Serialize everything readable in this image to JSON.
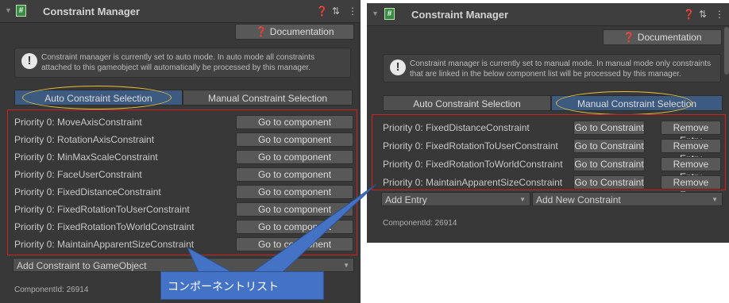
{
  "left": {
    "title": "Constraint Manager",
    "title_icons": [
      "help-icon",
      "sliders-icon",
      "kebab-menu-icon"
    ],
    "doc_button": "Documentation",
    "doc_icon": "help-icon",
    "help_text": "Constraint manager is currently set to auto mode. In auto mode all constraints attached to this gameobject will automatically be processed by this manager.",
    "tabs": [
      {
        "label": "Auto Constraint Selection",
        "active": true
      },
      {
        "label": "Manual Constraint Selection",
        "active": false
      }
    ],
    "rows": [
      {
        "label": "Priority 0: MoveAxisConstraint",
        "button": "Go to component"
      },
      {
        "label": "Priority 0: RotationAxisConstraint",
        "button": "Go to component"
      },
      {
        "label": "Priority 0: MinMaxScaleConstraint",
        "button": "Go to component"
      },
      {
        "label": "Priority 0: FaceUserConstraint",
        "button": "Go to component"
      },
      {
        "label": "Priority 0: FixedDistanceConstraint",
        "button": "Go to component"
      },
      {
        "label": "Priority 0: FixedRotationToUserConstraint",
        "button": "Go to component"
      },
      {
        "label": "Priority 0: FixedRotationToWorldConstraint",
        "button": "Go to component"
      },
      {
        "label": "Priority 0: MaintainApparentSizeConstraint",
        "button": "Go to component"
      }
    ],
    "add_dropdown": "Add Constraint to GameObject",
    "component_id": "ComponentId: 26914"
  },
  "right": {
    "title": "Constraint Manager",
    "title_icons": [
      "help-icon",
      "sliders-icon",
      "kebab-menu-icon"
    ],
    "doc_button": "Documentation",
    "doc_icon": "help-icon",
    "help_text": "Constraint manager is currently set to manual mode. In manual mode only constraints that are linked in the below component list will be processed by this manager.",
    "tabs": [
      {
        "label": "Auto Constraint Selection",
        "active": false
      },
      {
        "label": "Manual Constraint Selection",
        "active": true
      }
    ],
    "rows": [
      {
        "label": "Priority 0: FixedDistanceConstraint",
        "goto": "Go to Constraint",
        "remove": "Remove Entry"
      },
      {
        "label": "Priority 0: FixedRotationToUserConstraint",
        "goto": "Go to Constraint",
        "remove": "Remove Entry"
      },
      {
        "label": "Priority 0: FixedRotationToWorldConstraint",
        "goto": "Go to Constraint",
        "remove": "Remove Entry"
      },
      {
        "label": "Priority 0: MaintainApparentSizeConstraint",
        "goto": "Go to Constraint",
        "remove": "Remove Entry"
      }
    ],
    "add_entry_dropdown": "Add Entry",
    "add_new_dropdown": "Add New Constraint",
    "component_id": "ComponentId: 26914"
  },
  "callout": {
    "text": "コンポーネントリスト"
  },
  "colors": {
    "panel_bg": "#383838",
    "active_tab": "#3d5a80",
    "highlight_ellipse": "#e7c03a",
    "list_frame": "#d02020",
    "callout": "#4472c4",
    "script_icon": "#3a8a44"
  }
}
